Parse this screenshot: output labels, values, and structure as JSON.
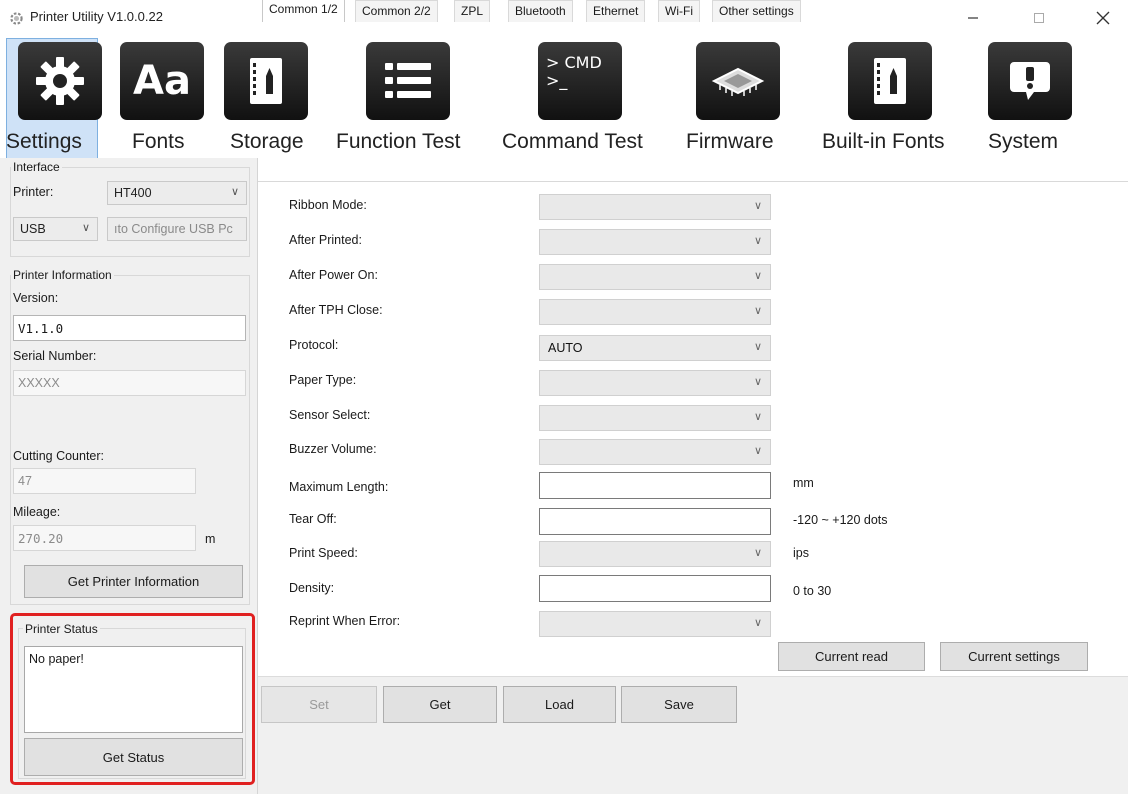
{
  "window": {
    "title": "Printer Utility  V1.0.0.22",
    "icons": {
      "app": "gear-app-icon",
      "minimize": "minimize-icon",
      "maximize": "maximize-icon",
      "close": "close-icon"
    }
  },
  "toolbar": {
    "items": [
      {
        "label": "Settings",
        "icon": "gear-icon",
        "active": true
      },
      {
        "label": "Fonts",
        "icon": "font-aa-icon"
      },
      {
        "label": "Storage",
        "icon": "storage-notebook-icon"
      },
      {
        "label": "Function Test",
        "icon": "list-icon"
      },
      {
        "label": "Command Test",
        "icon": "cmd-terminal-icon",
        "icon_text": "> CMD\n>_"
      },
      {
        "label": "Firmware",
        "icon": "chip-icon"
      },
      {
        "label": "Built-in Fonts",
        "icon": "notebook-pen-icon"
      },
      {
        "label": "System",
        "icon": "alert-bubble-icon"
      }
    ]
  },
  "interface": {
    "group_label": "Interface",
    "printer_label": "Printer:",
    "printer_value": "HT400",
    "port_value": "USB",
    "auto_config_label": "ıto Configure USB Pc"
  },
  "printer_info": {
    "group_label": "Printer Information",
    "version_label": "Version:",
    "version_value": "V1.1.0",
    "serial_label": "Serial Number:",
    "serial_value": "XXXXX",
    "cutting_label": "Cutting Counter:",
    "cutting_value": "47",
    "mileage_label": "Mileage:",
    "mileage_value": "270.20",
    "mileage_unit": "m",
    "get_info_button": "Get Printer Information"
  },
  "printer_status": {
    "group_label": "Printer Status",
    "text": "No paper!",
    "get_status_button": "Get Status"
  },
  "tabs": [
    {
      "label": "Common 1/2",
      "active": true
    },
    {
      "label": "Common 2/2"
    },
    {
      "label": "ZPL"
    },
    {
      "label": "Bluetooth"
    },
    {
      "label": "Ethernet"
    },
    {
      "label": "Wi-Fi"
    },
    {
      "label": "Other settings"
    }
  ],
  "settings": {
    "ribbon_mode": {
      "label": "Ribbon Mode:",
      "value": ""
    },
    "after_printed": {
      "label": "After Printed:",
      "value": ""
    },
    "after_power_on": {
      "label": "After Power On:",
      "value": ""
    },
    "after_tph_close": {
      "label": "After TPH Close:",
      "value": ""
    },
    "protocol": {
      "label": "Protocol:",
      "value": "AUTO"
    },
    "paper_type": {
      "label": "Paper Type:",
      "value": ""
    },
    "sensor_select": {
      "label": "Sensor Select:",
      "value": ""
    },
    "buzzer_volume": {
      "label": "Buzzer Volume:",
      "value": ""
    },
    "maximum_length": {
      "label": "Maximum Length:",
      "value": "",
      "unit": "mm"
    },
    "tear_off": {
      "label": "Tear Off:",
      "value": "",
      "unit": "-120 ~ +120 dots"
    },
    "print_speed": {
      "label": "Print Speed:",
      "value": "",
      "unit": "ips"
    },
    "density": {
      "label": "Density:",
      "value": "",
      "unit": "0 to 30"
    },
    "reprint_when_error": {
      "label": "Reprint When Error:",
      "value": ""
    }
  },
  "actions": {
    "current_read": "Current read",
    "current_settings": "Current settings",
    "set": "Set",
    "get": "Get",
    "load": "Load",
    "save": "Save"
  }
}
